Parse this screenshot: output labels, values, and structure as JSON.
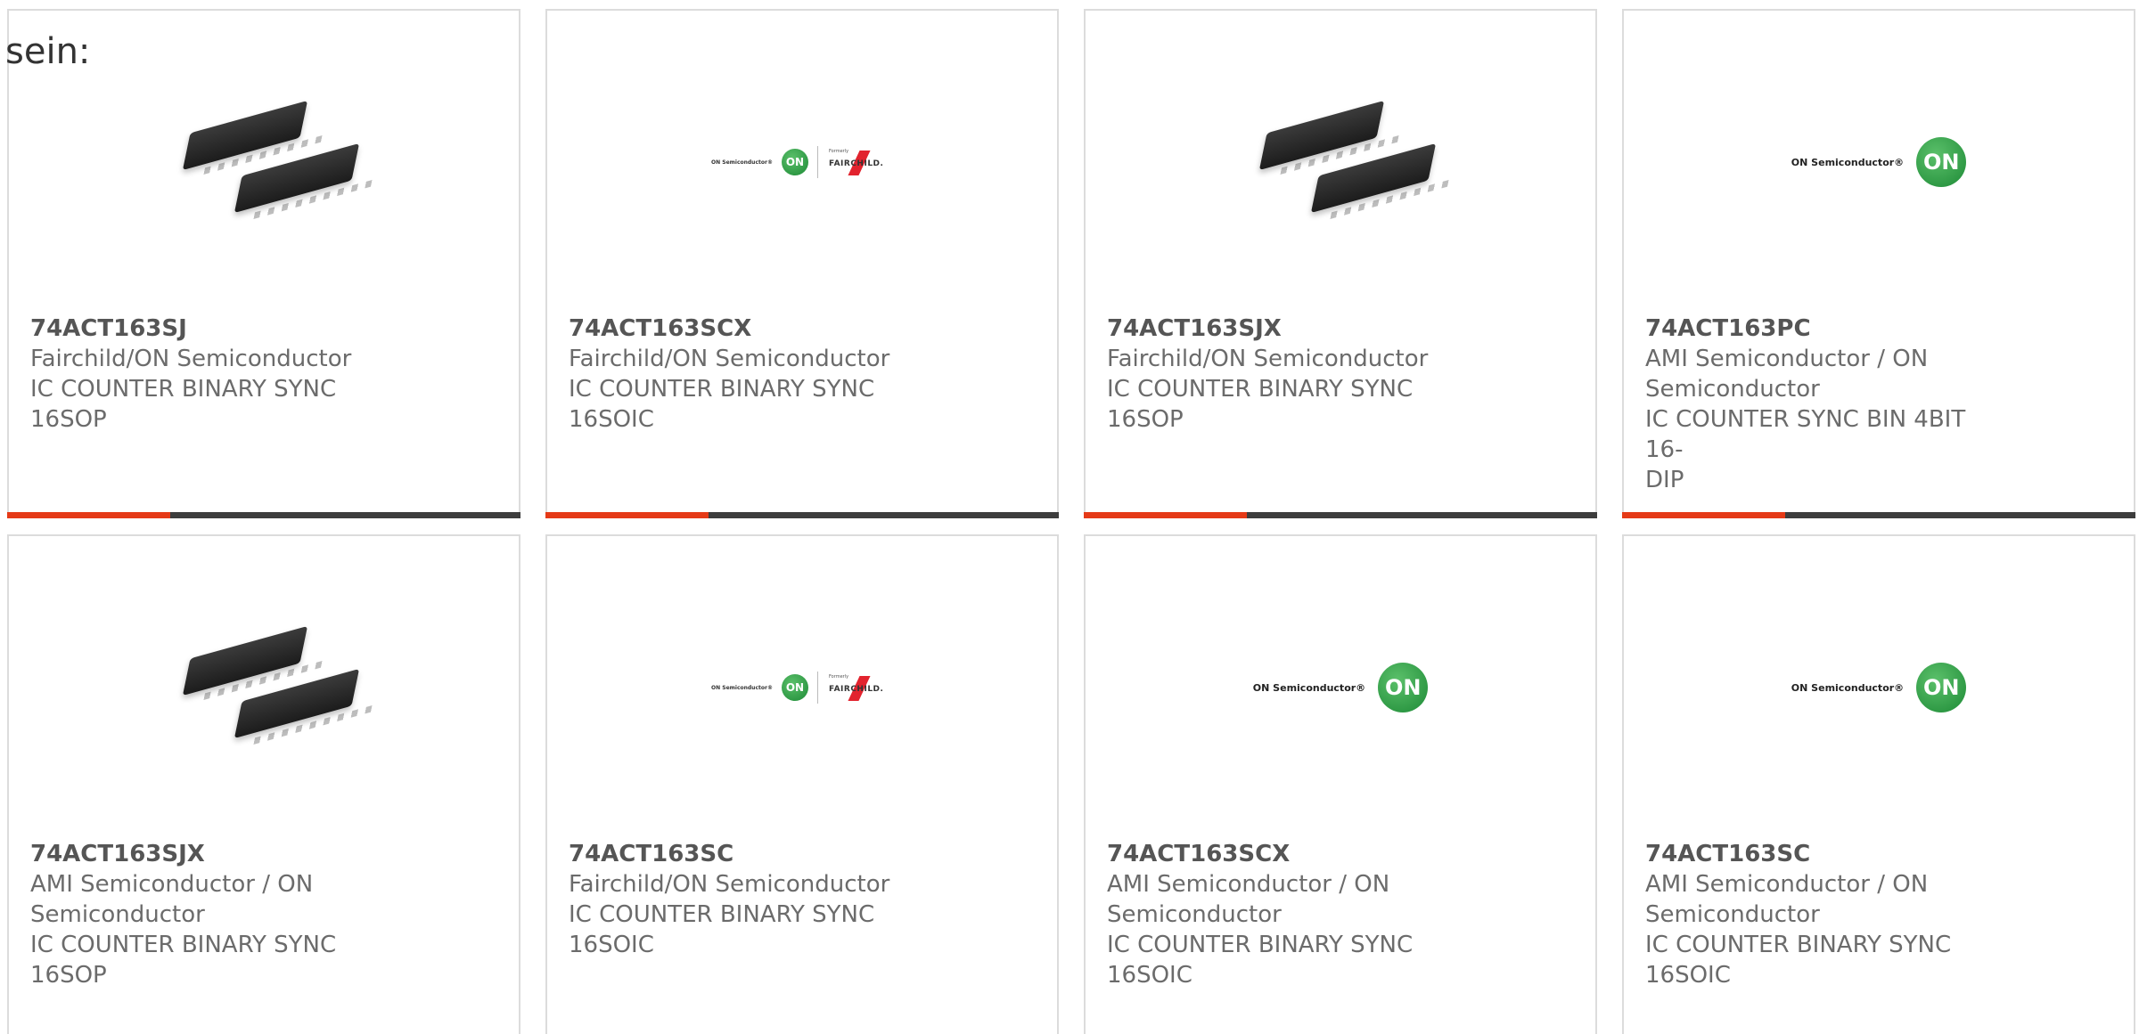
{
  "intro_text": "sein:",
  "cards": [
    {
      "part": "74ACT163SJ",
      "lines": [
        "Fairchild/ON Semiconductor",
        "IC COUNTER BINARY SYNC",
        "16SOP"
      ],
      "image": "chip",
      "has_bar": true
    },
    {
      "part": "74ACT163SCX",
      "lines": [
        "Fairchild/ON Semiconductor",
        "IC COUNTER BINARY SYNC",
        "16SOIC"
      ],
      "image": "on-fairchild-logo",
      "has_bar": true
    },
    {
      "part": "74ACT163SJX",
      "lines": [
        "Fairchild/ON Semiconductor",
        "IC COUNTER BINARY SYNC",
        "16SOP"
      ],
      "image": "chip",
      "has_bar": true
    },
    {
      "part": "74ACT163PC",
      "lines": [
        "AMI Semiconductor / ON",
        "Semiconductor",
        "IC COUNTER SYNC BIN 4BIT 16-",
        "DIP"
      ],
      "image": "on-logo",
      "has_bar": true
    },
    {
      "part": "74ACT163SJX",
      "lines": [
        "AMI Semiconductor / ON",
        "Semiconductor",
        "IC COUNTER BINARY SYNC",
        "16SOP"
      ],
      "image": "chip",
      "has_bar": false
    },
    {
      "part": "74ACT163SC",
      "lines": [
        "Fairchild/ON Semiconductor",
        "IC COUNTER BINARY SYNC",
        "16SOIC"
      ],
      "image": "on-fairchild-logo",
      "has_bar": false
    },
    {
      "part": "74ACT163SCX",
      "lines": [
        "AMI Semiconductor / ON",
        "Semiconductor",
        "IC COUNTER BINARY SYNC",
        "16SOIC"
      ],
      "image": "on-logo",
      "has_bar": false
    },
    {
      "part": "74ACT163SC",
      "lines": [
        "AMI Semiconductor / ON",
        "Semiconductor",
        "IC COUNTER BINARY SYNC",
        "16SOIC"
      ],
      "image": "on-logo",
      "has_bar": false
    }
  ],
  "logos": {
    "on_text": "ON Semiconductor®",
    "on_badge": "ON",
    "formerly": "Formerly",
    "fairchild": "FAIRCHILD."
  },
  "colors": {
    "accent": "#e53a17",
    "bar": "#3d3d3d",
    "on_green": "#1d8a36",
    "fairchild_red": "#e2232e"
  }
}
